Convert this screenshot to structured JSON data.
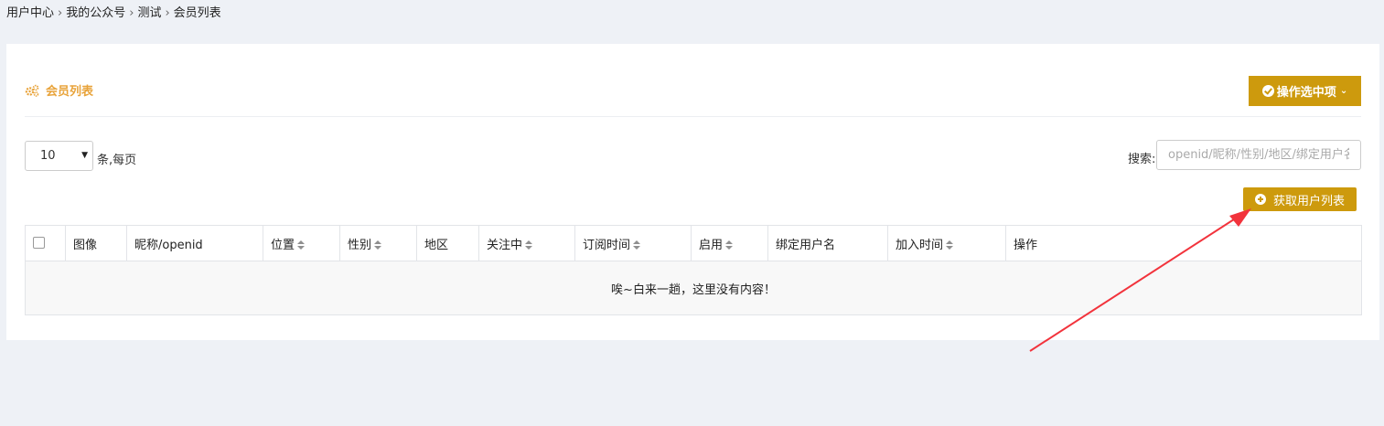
{
  "breadcrumb": [
    "用户中心",
    "我的公众号",
    "测试",
    "会员列表"
  ],
  "breadcrumb_sep": "›",
  "panel": {
    "title": "会员列表",
    "ops_button": "操作选中项"
  },
  "controls": {
    "page_size": "10",
    "per_page_suffix": "条,每页",
    "search_label": "搜索:",
    "search_placeholder": "openid/昵称/性别/地区/绑定用户名",
    "fetch_button": "获取用户列表"
  },
  "table": {
    "columns": [
      "图像",
      "昵称/openid",
      "位置",
      "性别",
      "地区",
      "关注中",
      "订阅时间",
      "启用",
      "绑定用户名",
      "加入时间",
      "操作"
    ],
    "empty_message": "唉~白来一趟，这里没有内容！"
  },
  "colors": {
    "accent": "#cd9a0d",
    "title": "#e8a33a",
    "annotation_arrow": "#f2333c"
  },
  "icons": [
    "gears-icon",
    "check-circle-icon",
    "chevron-down-icon",
    "plus-circle-icon",
    "sort-icon",
    "checkbox"
  ]
}
